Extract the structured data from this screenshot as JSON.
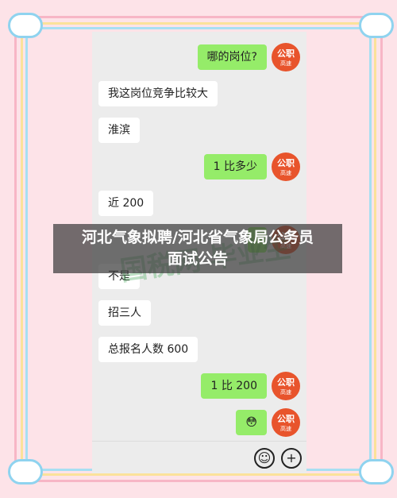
{
  "chat": {
    "messages": [
      {
        "side": "right",
        "text": "哪的岗位?"
      },
      {
        "side": "left",
        "text": "我这岗位竞争比较大"
      },
      {
        "side": "left",
        "text": "淮滨"
      },
      {
        "side": "right",
        "text": "1 比多少"
      },
      {
        "side": "left",
        "text": "近 200"
      },
      {
        "side": "right",
        "text": ""
      },
      {
        "side": "left",
        "text": "不是"
      },
      {
        "side": "left",
        "text": "招三人"
      },
      {
        "side": "left",
        "text": "总报名人数 600"
      },
      {
        "side": "right",
        "text": "1 比 200"
      },
      {
        "side": "right",
        "text": "😳"
      }
    ],
    "avatar": {
      "brand": "公职",
      "sub": "高速"
    }
  },
  "input_bar": {
    "emoji_icon": "emoji-icon",
    "plus_icon": "plus-icon",
    "emoji_glyph": "☺",
    "plus_glyph": "+"
  },
  "overlay": {
    "title_line1": "河北气象拟聘/河北省气象局公务员",
    "title_line2": "面试公告"
  },
  "watermark": {
    "text": "国税网 毕业生"
  },
  "colors": {
    "sent_bubble": "#95ec69",
    "received_bubble": "#ffffff",
    "avatar_bg": "#e8542c"
  }
}
